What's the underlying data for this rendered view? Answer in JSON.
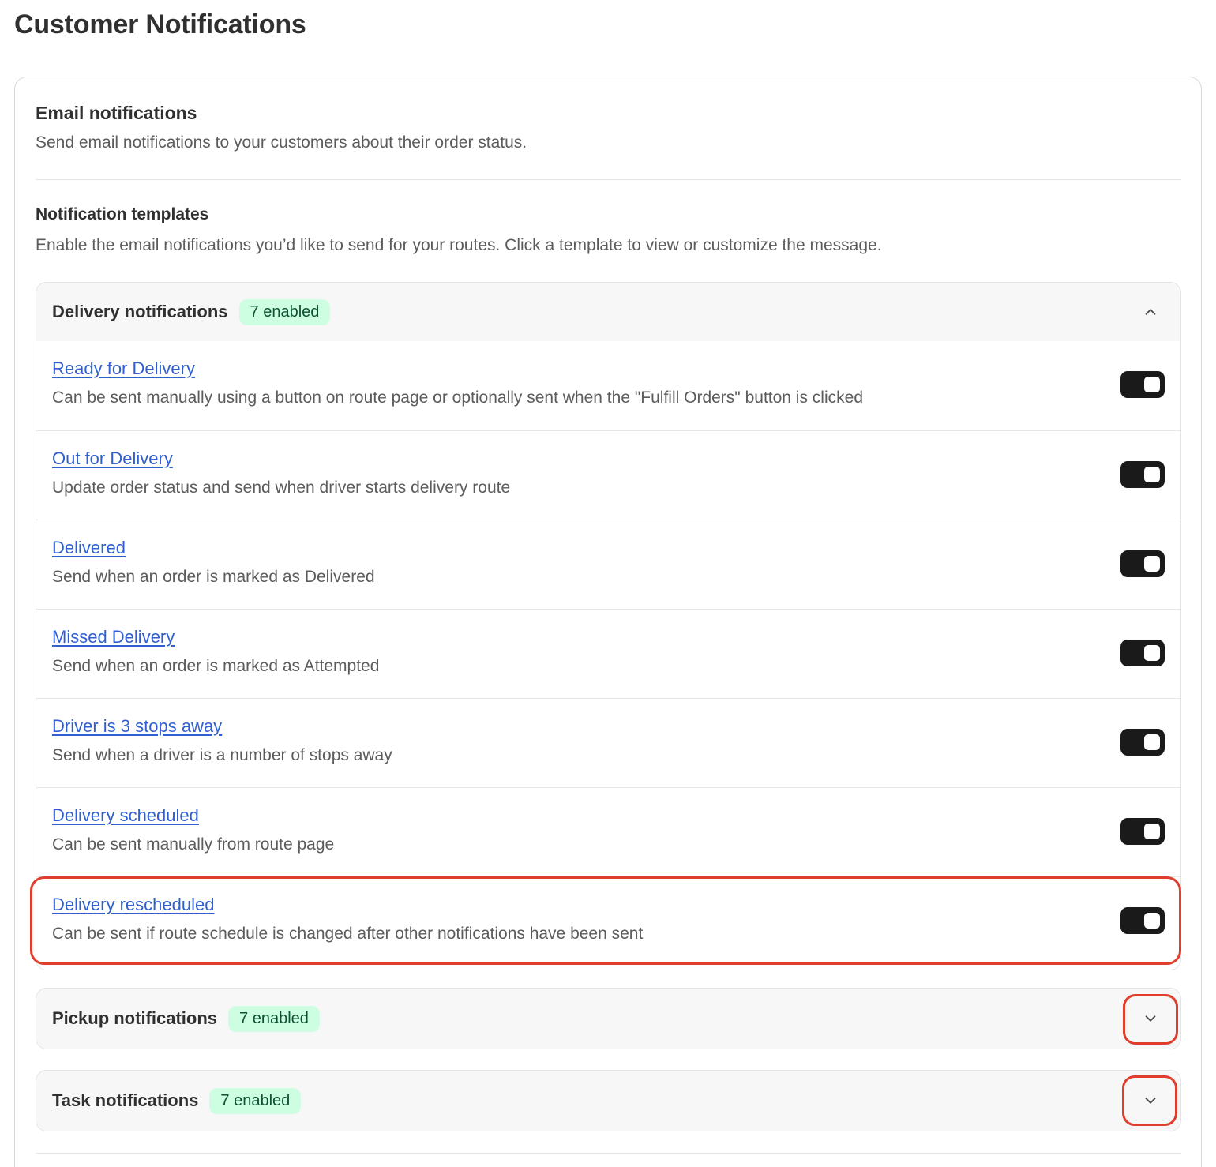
{
  "page": {
    "title": "Customer Notifications"
  },
  "email": {
    "title": "Email notifications",
    "description": "Send email notifications to your customers about their order status."
  },
  "templates": {
    "title": "Notification templates",
    "description": "Enable the email notifications you’d like to send for your routes. Click a template to view or customize the message."
  },
  "groups": {
    "delivery": {
      "title": "Delivery notifications",
      "badge": "7 enabled",
      "expanded": true,
      "items": [
        {
          "label": "Ready for Delivery",
          "description": "Can be sent manually using a button on route page or optionally sent when the \"Fulfill Orders\" button is clicked",
          "enabled": true
        },
        {
          "label": "Out for Delivery",
          "description": "Update order status and send when driver starts delivery route",
          "enabled": true
        },
        {
          "label": "Delivered",
          "description": "Send when an order is marked as Delivered",
          "enabled": true
        },
        {
          "label": "Missed Delivery",
          "description": "Send when an order is marked as Attempted",
          "enabled": true
        },
        {
          "label": "Driver is 3 stops away",
          "description": "Send when a driver is a number of stops away",
          "enabled": true
        },
        {
          "label": "Delivery scheduled",
          "description": "Can be sent manually from route page",
          "enabled": true
        },
        {
          "label": "Delivery rescheduled",
          "description": "Can be sent if route schedule is changed after other notifications have been sent",
          "enabled": true
        }
      ]
    },
    "pickup": {
      "title": "Pickup notifications",
      "badge": "7 enabled",
      "expanded": false
    },
    "task": {
      "title": "Task notifications",
      "badge": "7 enabled",
      "expanded": false
    }
  },
  "colors": {
    "badge_bg": "#cdfee1",
    "badge_text": "#0c5132",
    "link": "#2f5fd0",
    "toggle_on": "#1a1a1a",
    "highlight": "#e03e2d"
  }
}
